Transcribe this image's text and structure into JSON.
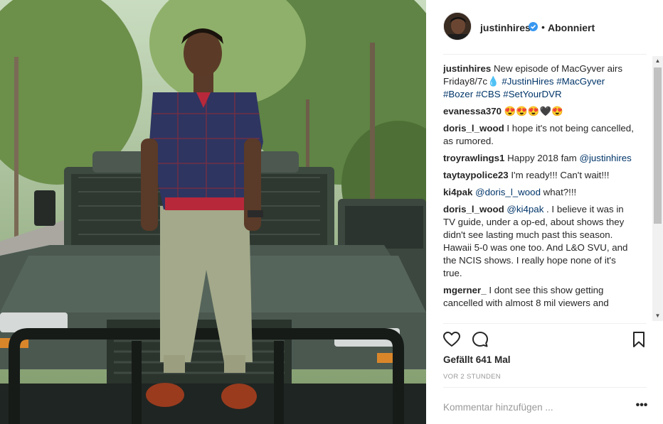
{
  "post": {
    "username": "justinhires",
    "follow_status": "Abonniert",
    "separator": "•",
    "verified_icon": "verified-badge-icon",
    "caption": {
      "username": "justinhires",
      "text": "New episode of MacGyver airs Friday8/7c",
      "emoji": "💧",
      "hashtags": [
        "#JustinHires",
        "#MacGyver",
        "#Bozer",
        "#CBS",
        "#SetYourDVR"
      ]
    },
    "comments": [
      {
        "username": "evanessa370",
        "text": "😍😍😍🖤😍"
      },
      {
        "username": "doris_l_wood",
        "text": "I hope it's not being cancelled, as rumored."
      },
      {
        "username": "troyrawlings1",
        "text": "Happy 2018 fam",
        "mention": "@justinhires"
      },
      {
        "username": "taytaypolice23",
        "text": "I'm ready!!! Can't wait!!!"
      },
      {
        "username": "ki4pak",
        "mention": "@doris_l_wood",
        "text": "what?!!!"
      },
      {
        "username": "doris_l_wood",
        "mention": "@ki4pak",
        "text": ". I believe it was in TV guide, under a op-ed, about shows they didn't see lasting much past this season. Hawaii 5-0 was one too. And L&O SVU, and the NCIS shows. I really hope none of it's true."
      },
      {
        "username": "mgerner_",
        "text": "I dont see this show getting cancelled with almost 8 mil viewers and"
      }
    ],
    "likes_text": "Gefällt 641 Mal",
    "timestamp": "VOR 2 STUNDEN",
    "comment_placeholder": "Kommentar hinzufügen ...",
    "more_label": "•••",
    "icons": {
      "like": "heart-icon",
      "comment": "comment-bubble-icon",
      "save": "bookmark-icon",
      "more": "more-options-icon"
    }
  },
  "colors": {
    "text": "#262626",
    "link": "#003569",
    "verified": "#3897f0",
    "muted": "#999999",
    "divider": "#efefef"
  }
}
